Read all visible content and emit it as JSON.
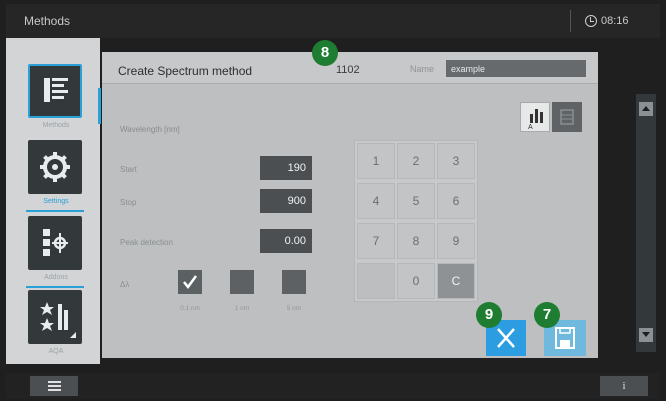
{
  "topbar": {
    "title": "Methods",
    "time": "08:16"
  },
  "sidenav": {
    "items": [
      {
        "label": "Methods",
        "icon": "list-icon",
        "active": true
      },
      {
        "label": "Settings",
        "icon": "gear-icon",
        "active": false
      },
      {
        "label": "Addons",
        "icon": "plugin-icon",
        "active": false
      },
      {
        "label": "AQA",
        "icon": "star-icon",
        "active": false
      }
    ]
  },
  "panel": {
    "title": "Create Spectrum method",
    "method_number": "1102",
    "name_label": "Name",
    "name_value": "example",
    "wavelength_label": "Wavelength [nm]",
    "fields": [
      {
        "label": "Start",
        "value": "190"
      },
      {
        "label": "Stop",
        "value": "900"
      },
      {
        "label": "Peak detection",
        "value": "0.00"
      }
    ],
    "resolution": {
      "label": "Δλ",
      "options": [
        {
          "label": "0.1 nm",
          "checked": true
        },
        {
          "label": "1 nm",
          "checked": false
        },
        {
          "label": "5 nm",
          "checked": false
        }
      ]
    },
    "keypad": [
      "1",
      "2",
      "3",
      "4",
      "5",
      "6",
      "7",
      "8",
      "9",
      ".",
      "0",
      "C"
    ]
  },
  "badges": {
    "title_badge": "8",
    "cancel_badge": "9",
    "save_badge": "7"
  },
  "colors": {
    "accent": "#2aa0d6",
    "badge": "#1f7d32",
    "cancel": "#2b9de0",
    "save": "#6fb9de"
  },
  "bottombar": {
    "info_label": "i"
  }
}
